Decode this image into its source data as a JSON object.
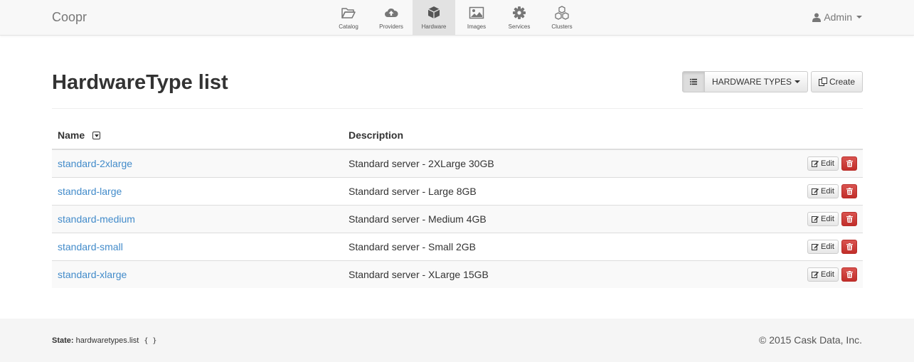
{
  "brand": "Coopr",
  "nav": [
    {
      "label": "Catalog",
      "icon": "folder-open-icon",
      "active": false
    },
    {
      "label": "Providers",
      "icon": "cloud-upload-icon",
      "active": false
    },
    {
      "label": "Hardware",
      "icon": "cube-icon",
      "active": true
    },
    {
      "label": "Images",
      "icon": "picture-icon",
      "active": false
    },
    {
      "label": "Services",
      "icon": "gear-icon",
      "active": false
    },
    {
      "label": "Clusters",
      "icon": "cubes-icon",
      "active": false
    }
  ],
  "user": {
    "label": "Admin"
  },
  "page": {
    "title": "HardwareType list",
    "dropdown_label": "HARDWARE TYPES",
    "create_label": "Create"
  },
  "table": {
    "columns": [
      "Name",
      "Description"
    ],
    "edit_label": "Edit",
    "rows": [
      {
        "name": "standard-2xlarge",
        "description": "Standard server - 2XLarge 30GB"
      },
      {
        "name": "standard-large",
        "description": "Standard server - Large 8GB"
      },
      {
        "name": "standard-medium",
        "description": "Standard server - Medium 4GB"
      },
      {
        "name": "standard-small",
        "description": "Standard server - Small 2GB"
      },
      {
        "name": "standard-xlarge",
        "description": "Standard server - XLarge 15GB"
      }
    ]
  },
  "footer": {
    "state_label": "State:",
    "state_value": "hardwaretypes.list",
    "state_params": "{ }",
    "copyright": "© 2015 Cask Data, Inc."
  },
  "colors": {
    "link": "#428bca",
    "danger": "#d9534f",
    "navbar_bg": "#f8f8f8",
    "active_nav_bg": "#e2e2e2"
  }
}
